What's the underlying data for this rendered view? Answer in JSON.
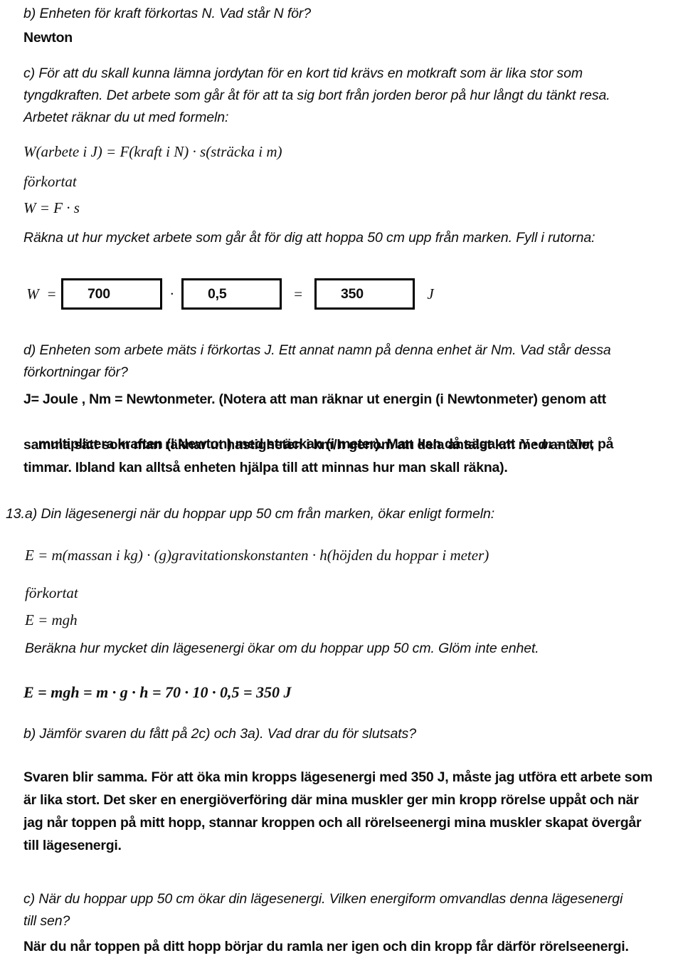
{
  "document": {
    "language": "sv",
    "page_background": "#ffffff",
    "text_color": "#0d0d0d"
  },
  "blocks": {
    "q12b_question": "b) Enheten för kraft förkortas N. Vad står N för?",
    "q12b_answer": "Newton",
    "q12c_question_line1": "c) För att du skall kunna lämna jordytan för en kort tid krävs en motkraft som är lika stor som",
    "q12c_question_line2": "tyngdkraften. Det arbete som går åt för att ta sig bort från jorden beror på hur långt du tänkt resa.",
    "q12c_question_line3": "Arbetet räknar du ut med formeln:",
    "formula_work_full": "W(arbete i J) = F(kraft i N) · s(sträcka i m)",
    "label_forkortat_1": "förkortat",
    "formula_work_short": "W = F · s",
    "q12c_instruction": "Räkna ut hur mycket arbete som går åt för dig att hoppa 50 cm upp från marken. Fyll i rutorna:",
    "q12d_question_line1": "d) Enheten som arbete mäts i förkortas J. Ett annat namn på denna enhet är Nm. Vad står dessa",
    "q12d_question_line2": "förkortningar för?",
    "q12d_answer_line1_pre": "J= Joule , Nm = Newtonmeter. (Notera att man räknar ut energin (i Newtonmeter) genom att",
    "q12d_answer_line2_pre": "multiplicera kraften (i Newton) med sträckan (i meter). Man kan då säga att ",
    "q12d_answer_inline_math": "N · m = Nm",
    "q12d_answer_line2_post": ", på",
    "q12d_answer_line3": "samma sätt som man räknar ut hastigheten i km/h genom att dela antalet km med antalet",
    "q12d_answer_line4": "timmar. Ibland kan alltså enheten hjälpa till att minnas hur man skall räkna).",
    "q13_number": "13.",
    "q13a_question": "a) Din lägesenergi när du hoppar upp 50 cm från marken, ökar enligt formeln:",
    "formula_energy_full": "E = m(massan i kg) · (g)gravitationskonstanten · h(höjden du hoppar i meter)",
    "label_forkortat_2": "förkortat",
    "formula_energy_short": "E = mgh",
    "q13a_instruction": "Beräkna hur mycket din lägesenergi ökar om du hoppar upp 50 cm. Glöm inte enhet.",
    "q13a_answer_formula": "E = mgh = m · g · h = 70 · 10 · 0,5 = 350 J",
    "q13b_question": "b) Jämför svaren du fått på 2c) och 3a). Vad drar du för slutsats?",
    "q13b_answer_line1": "Svaren blir samma. För att öka min kropps lägesenergi med 350 J, måste jag utföra ett arbete som",
    "q13b_answer_line2": "är lika stort. Det sker en energiöverföring där mina muskler ger min kropp rörelse uppåt och när",
    "q13b_answer_line3": "jag når toppen på mitt hopp, stannar kroppen och all rörelseenergi mina muskler skapat övergår",
    "q13b_answer_line4": "till lägesenergi.",
    "q13c_question_line1": "c) När du hoppar upp 50 cm ökar din lägesenergi. Vilken energiform omvandlas denna lägesenergi",
    "q13c_question_line2": "till sen?",
    "q13c_answer": "När du når toppen på ditt hopp börjar du ramla ner igen och din kropp får därför rörelseenergi."
  },
  "answer_row": {
    "lhs_symbol": "W",
    "equals_1": "=",
    "multiply": "·",
    "equals_2": "=",
    "unit": "J",
    "box_1_value": "700",
    "box_2_value": "0,5",
    "box_3_value": "350",
    "border_color": "#000000"
  }
}
